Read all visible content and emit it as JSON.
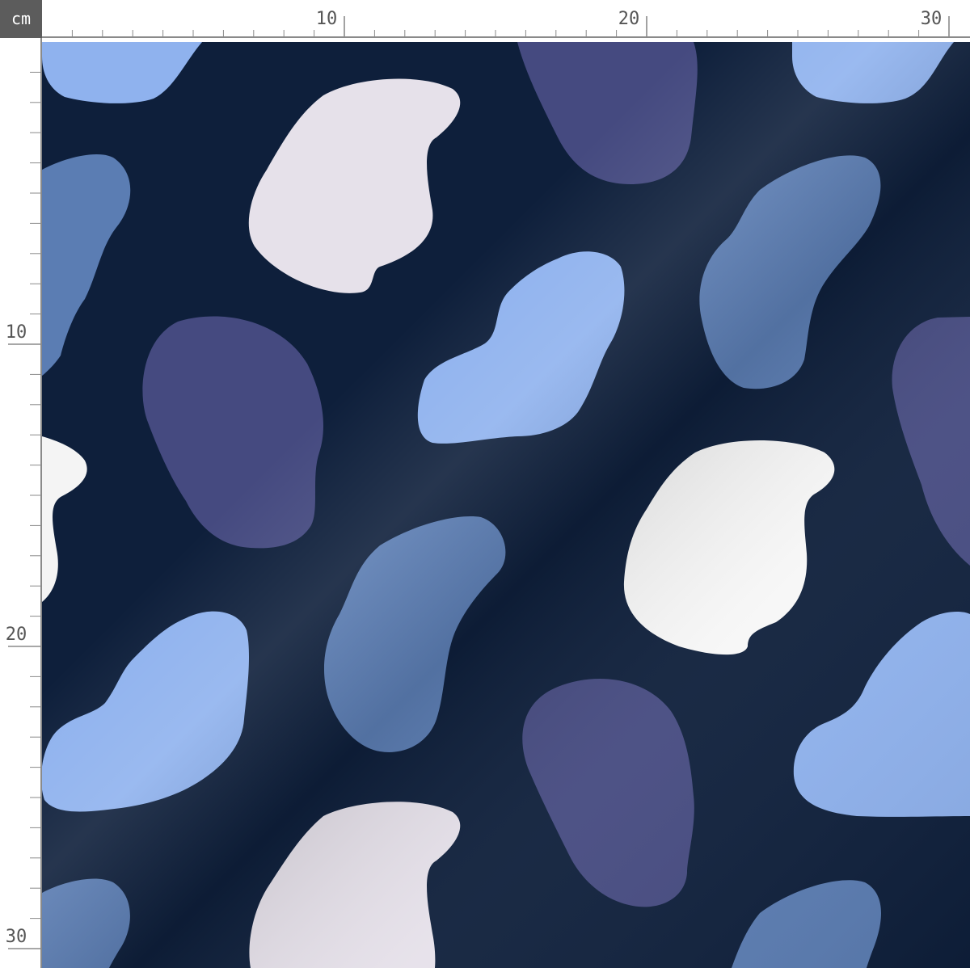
{
  "ruler": {
    "unit_label": "cm",
    "top_labels": [
      "10",
      "20",
      "30"
    ],
    "left_labels": [
      "10",
      "20",
      "30"
    ]
  },
  "colors": {
    "ruler_corner_bg": "#5c5c5c",
    "ruler_text": "#555555",
    "ruler_ticks": "#8a8a8a",
    "fabric_background": "#0e1f3b",
    "spot_light_blue": "#8fb2ee",
    "spot_mid_blue": "#5b7db3",
    "spot_purple": "#454a80",
    "spot_lavender_white": "#e6e1ea",
    "spot_white": "#f7f7f7"
  },
  "fabric": {
    "pattern": "abstract cow-spot blobs",
    "spot_colors": [
      "light blue",
      "medium blue",
      "slate purple",
      "lavender white",
      "white"
    ]
  }
}
